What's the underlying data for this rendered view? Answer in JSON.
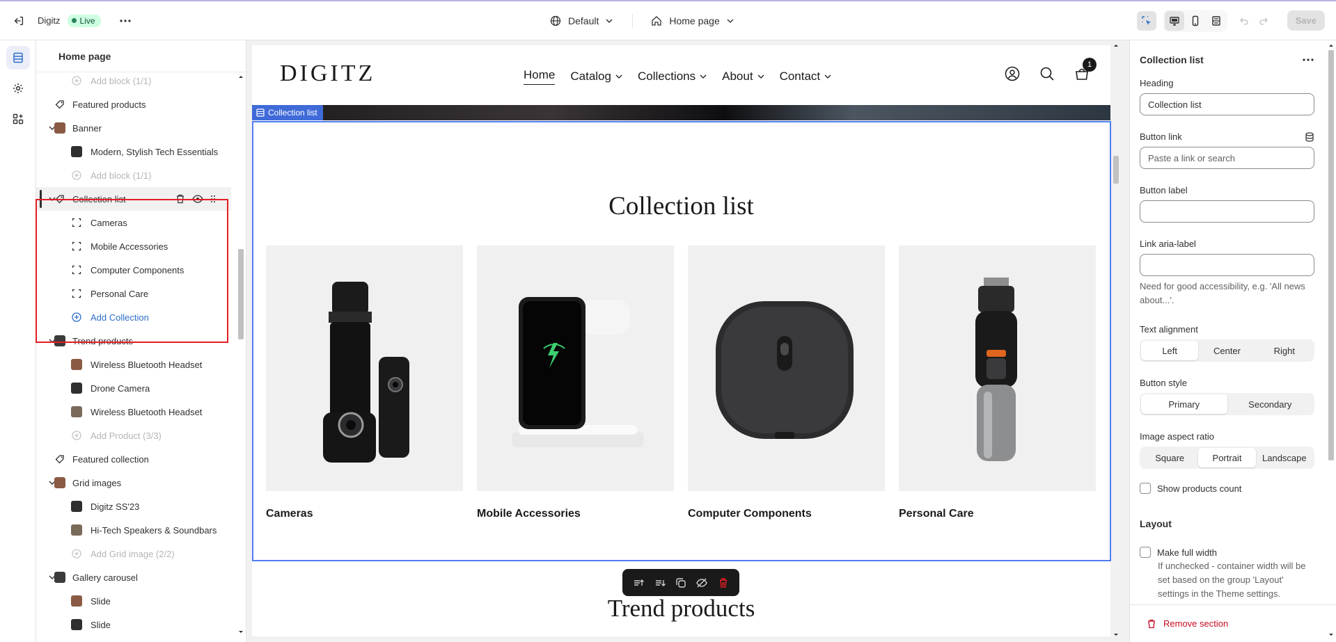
{
  "topbar": {
    "store_name": "Digitz",
    "status": "Live",
    "theme_selector": "Default",
    "page_selector": "Home page",
    "save_label": "Save",
    "icons": {
      "exit": "exit-icon",
      "more": "more-horizontal-icon",
      "globe": "globe-icon",
      "home": "home-icon",
      "inspect": "inspect-cursor-icon",
      "desktop": "desktop-icon",
      "mobile": "mobile-icon",
      "fullwidth": "fullwidth-icon",
      "undo": "undo-icon",
      "redo": "redo-icon"
    }
  },
  "rail": {
    "items": [
      "sections-icon",
      "settings-gear-icon",
      "apps-icon"
    ]
  },
  "tree": {
    "title": "Home page",
    "rows": [
      {
        "label": "Add block (1/1)",
        "type": "add",
        "muted": true
      },
      {
        "label": "Featured products",
        "type": "section"
      },
      {
        "label": "Banner",
        "type": "section-open"
      },
      {
        "label": "Modern, Stylish Tech Essentials",
        "type": "block"
      },
      {
        "label": "Add block (1/1)",
        "type": "add",
        "muted": true
      },
      {
        "label": "Collection list",
        "type": "section-open",
        "selected": true
      },
      {
        "label": "Cameras",
        "type": "block"
      },
      {
        "label": "Mobile Accessories",
        "type": "block"
      },
      {
        "label": "Computer Components",
        "type": "block"
      },
      {
        "label": "Personal Care",
        "type": "block"
      },
      {
        "label": "Add Collection",
        "type": "add",
        "blue": true
      },
      {
        "label": "Trend products",
        "type": "section-open"
      },
      {
        "label": "Wireless Bluetooth Headset",
        "type": "block"
      },
      {
        "label": "Drone Camera",
        "type": "block"
      },
      {
        "label": "Wireless Bluetooth Headset",
        "type": "block"
      },
      {
        "label": "Add Product (3/3)",
        "type": "add",
        "muted": true
      },
      {
        "label": "Featured collection",
        "type": "section"
      },
      {
        "label": "Grid images",
        "type": "section-open"
      },
      {
        "label": "Digitz SS'23",
        "type": "block"
      },
      {
        "label": "Hi-Tech Speakers & Soundbars",
        "type": "block"
      },
      {
        "label": "Add Grid image (2/2)",
        "type": "add",
        "muted": true
      },
      {
        "label": "Gallery carousel",
        "type": "section-open"
      },
      {
        "label": "Slide",
        "type": "block"
      },
      {
        "label": "Slide",
        "type": "block"
      }
    ]
  },
  "preview": {
    "logo": "DIGITZ",
    "nav": [
      "Home",
      "Catalog",
      "Collections",
      "About",
      "Contact"
    ],
    "cart_count": "1",
    "section_label": "Collection list",
    "collection_title": "Collection list",
    "collections": [
      "Cameras",
      "Mobile Accessories",
      "Computer Components",
      "Personal Care"
    ],
    "next_section_title": "Trend products"
  },
  "settings": {
    "title": "Collection list",
    "heading_label": "Heading",
    "heading_value": "Collection list",
    "button_link_label": "Button link",
    "button_link_placeholder": "Paste a link or search",
    "button_label_label": "Button label",
    "button_label_value": "",
    "aria_label": "Link aria-label",
    "aria_value": "",
    "aria_help": "Need for good accessibility, e.g. 'All news about...'.",
    "text_alignment_label": "Text alignment",
    "text_alignment_options": [
      "Left",
      "Center",
      "Right"
    ],
    "text_alignment_selected": "Left",
    "button_style_label": "Button style",
    "button_style_options": [
      "Primary",
      "Secondary"
    ],
    "button_style_selected": "Primary",
    "aspect_label": "Image aspect ratio",
    "aspect_options": [
      "Square",
      "Portrait",
      "Landscape"
    ],
    "aspect_selected": "Portrait",
    "show_count_label": "Show products count",
    "show_count_checked": false,
    "layout_heading": "Layout",
    "full_width_label": "Make full width",
    "full_width_checked": false,
    "full_width_help": "If unchecked - container width will be set based on the group 'Layout' settings in the Theme settings.",
    "remove_label": "Remove section"
  }
}
